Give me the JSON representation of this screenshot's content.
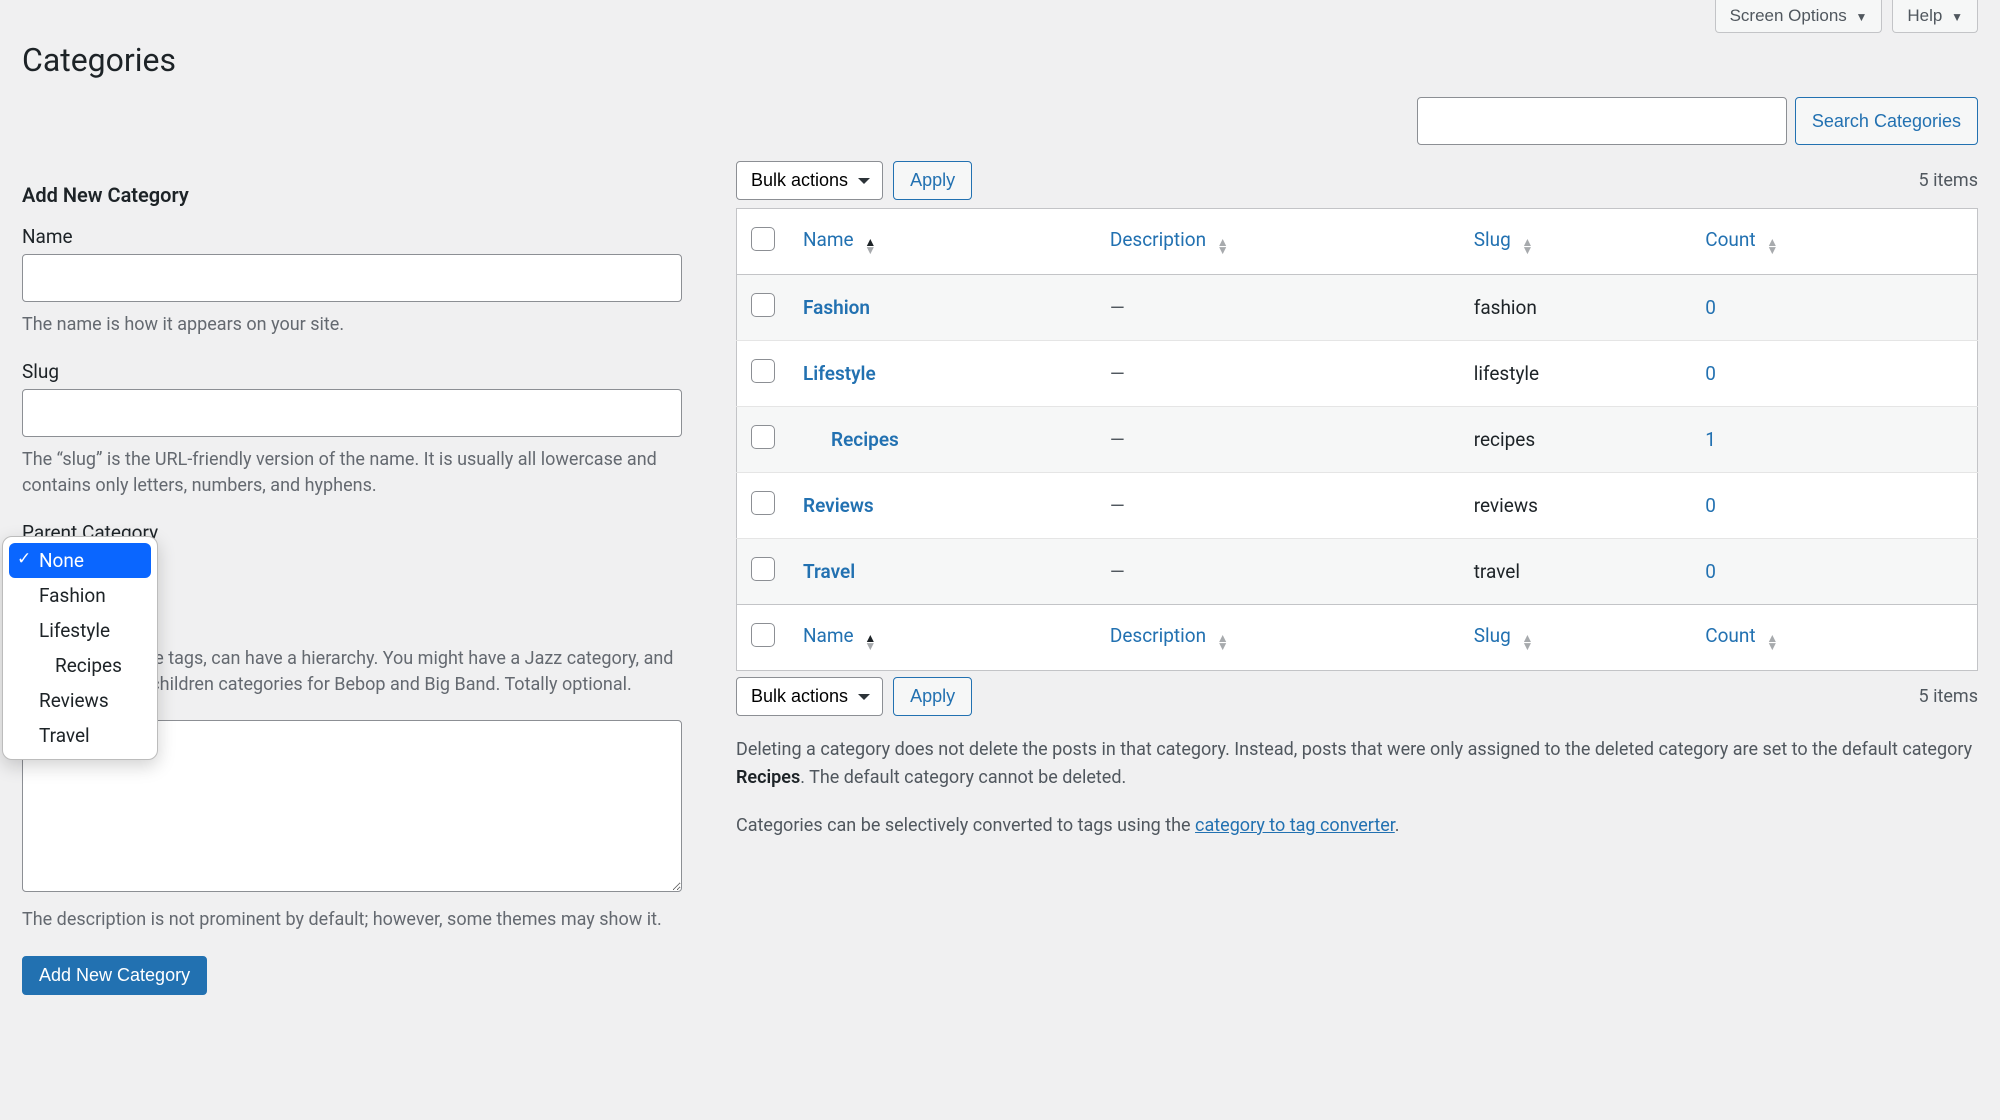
{
  "top_tabs": {
    "screen_options": "Screen Options",
    "help": "Help"
  },
  "page_title": "Categories",
  "search": {
    "button": "Search Categories"
  },
  "form": {
    "heading": "Add New Category",
    "name_label": "Name",
    "name_help": "The name is how it appears on your site.",
    "slug_label": "Slug",
    "slug_help": "The “slug” is the URL-friendly version of the name. It is usually all lowercase and contains only letters, numbers, and hyphens.",
    "parent_label": "Parent Category",
    "parent_help": "Categories, unlike tags, can have a hierarchy. You might have a Jazz category, and under that have children categories for Bebop and Big Band. Totally optional.",
    "desc_help": "The description is not prominent by default; however, some themes may show it.",
    "submit": "Add New Category"
  },
  "parent_options": [
    "None",
    "Fashion",
    "Lifestyle",
    "Recipes",
    "Reviews",
    "Travel"
  ],
  "parent_selected_index": 0,
  "bulk": {
    "label": "Bulk actions",
    "apply": "Apply"
  },
  "items_count": "5 items",
  "columns": {
    "name": "Name",
    "description": "Description",
    "slug": "Slug",
    "count": "Count"
  },
  "rows": [
    {
      "name": "Fashion",
      "description": "—",
      "slug": "fashion",
      "count": "0",
      "indent": false
    },
    {
      "name": "Lifestyle",
      "description": "—",
      "slug": "lifestyle",
      "count": "0",
      "indent": false
    },
    {
      "name": "Recipes",
      "description": "—",
      "slug": "recipes",
      "count": "1",
      "indent": true
    },
    {
      "name": "Reviews",
      "description": "—",
      "slug": "reviews",
      "count": "0",
      "indent": false
    },
    {
      "name": "Travel",
      "description": "—",
      "slug": "travel",
      "count": "0",
      "indent": false
    }
  ],
  "info": {
    "delete_pre": "Deleting a category does not delete the posts in that category. Instead, posts that were only assigned to the deleted category are set to the default category ",
    "delete_strong": "Recipes",
    "delete_post": ". The default category cannot be deleted.",
    "convert_pre": "Categories can be selectively converted to tags using the ",
    "convert_link": "category to tag converter",
    "convert_post": "."
  }
}
